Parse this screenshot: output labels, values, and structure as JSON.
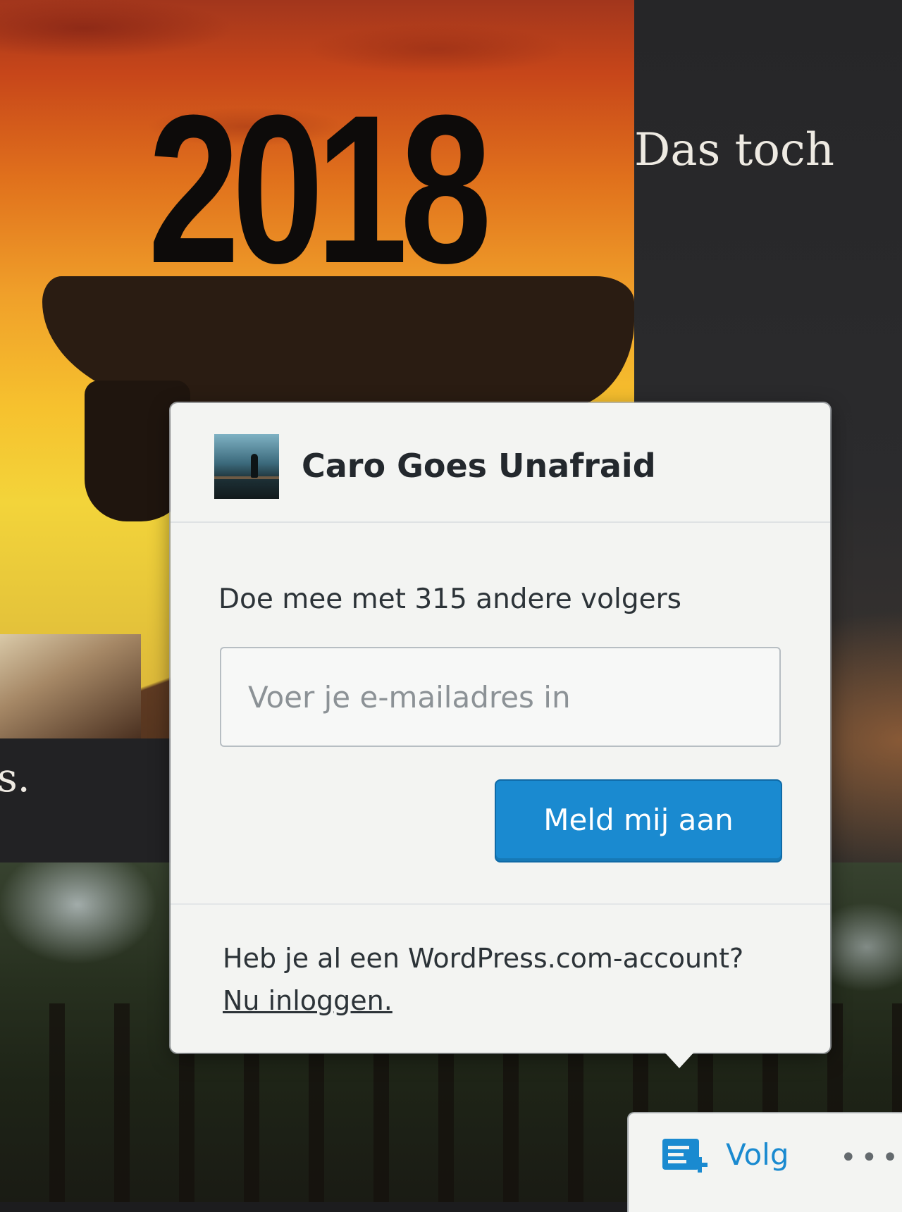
{
  "hero": {
    "year_text": "2018"
  },
  "side_text": "Das toch",
  "side_text_fragment": "s.",
  "popup": {
    "site_title": "Caro Goes Unafraid",
    "followers_text": "Doe mee met 315 andere volgers",
    "email_placeholder": "Voer je e-mailadres in",
    "subscribe_label": "Meld mij aan",
    "login_prompt": "Heb je al een WordPress.com-account? ",
    "login_link": "Nu inloggen."
  },
  "follow_bar": {
    "follow_label": "Volg",
    "follow_icon": "reader-follow-icon",
    "more_icon": "ellipsis-icon"
  },
  "colors": {
    "accent": "#1a8ad0",
    "popup_background": "#f3f4f2",
    "text": "#2c3338"
  }
}
